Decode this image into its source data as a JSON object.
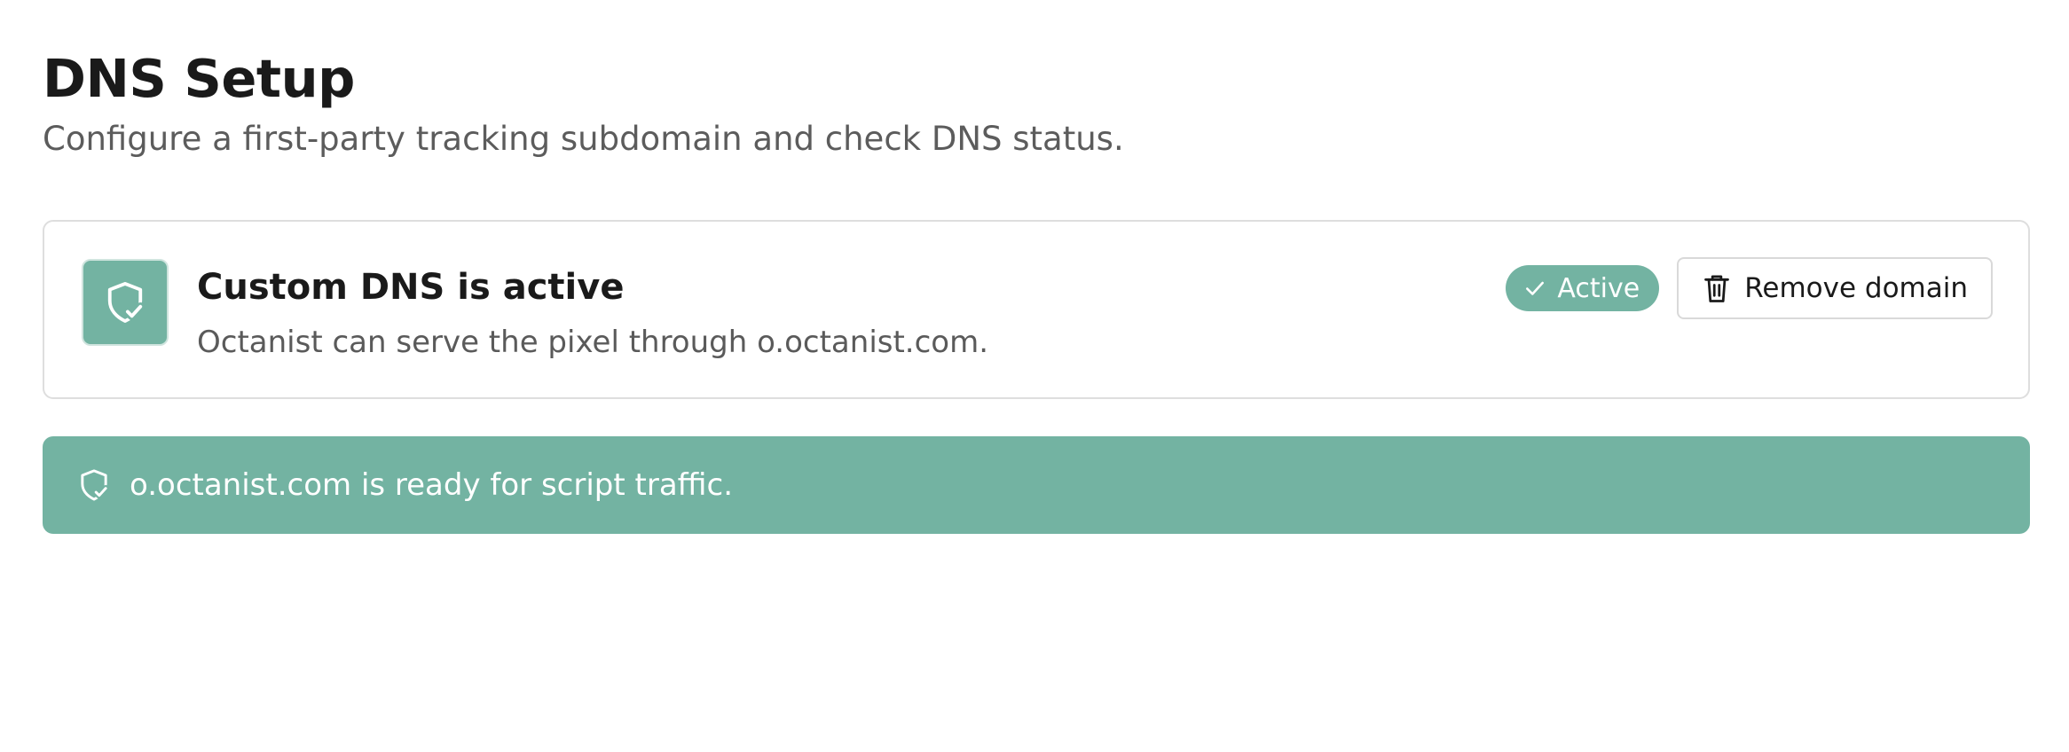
{
  "header": {
    "title": "DNS Setup",
    "subtitle": "Configure a first-party tracking subdomain and check DNS status."
  },
  "dns_card": {
    "icon": "shield-check-icon",
    "title": "Custom DNS is active",
    "description": "Octanist can serve the pixel through o.octanist.com.",
    "status_badge": {
      "icon": "check-icon",
      "label": "Active"
    },
    "remove_button": {
      "icon": "trash-icon",
      "label": "Remove domain"
    }
  },
  "alert": {
    "icon": "shield-check-icon",
    "message": "o.octanist.com is ready for script traffic."
  },
  "colors": {
    "accent": "#73b3a2",
    "text_primary": "#1a1a1a",
    "text_secondary": "#5c5c5c",
    "border": "#dedede"
  }
}
